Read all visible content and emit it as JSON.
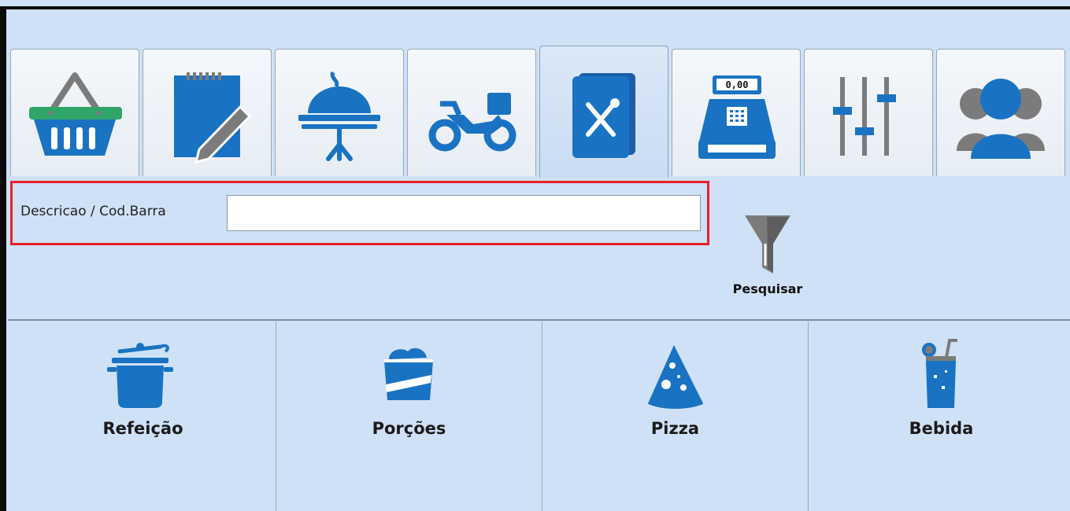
{
  "tabs": [
    {
      "icon": "basket-icon"
    },
    {
      "icon": "notepad-pencil-icon"
    },
    {
      "icon": "serving-table-icon"
    },
    {
      "icon": "motorcycle-delivery-icon"
    },
    {
      "icon": "menu-book-icon",
      "active": true
    },
    {
      "icon": "cash-register-icon",
      "display": "0,00"
    },
    {
      "icon": "sliders-icon"
    },
    {
      "icon": "users-icon"
    }
  ],
  "search": {
    "label": "Descricao / Cod.Barra",
    "value": "",
    "placeholder": ""
  },
  "filter": {
    "label": "Pesquisar",
    "icon": "funnel-icon"
  },
  "categories": [
    {
      "label": "Refeição",
      "icon": "pot-icon"
    },
    {
      "label": "Porções",
      "icon": "portion-box-icon"
    },
    {
      "label": "Pizza",
      "icon": "pizza-slice-icon"
    },
    {
      "label": "Bebida",
      "icon": "drink-glass-icon"
    }
  ],
  "colors": {
    "background": "#cfe1f6",
    "icon_blue": "#1a73c2",
    "icon_gray": "#7b7b7b",
    "basket_green": "#2fa56a",
    "highlight_red": "#e8202a"
  }
}
